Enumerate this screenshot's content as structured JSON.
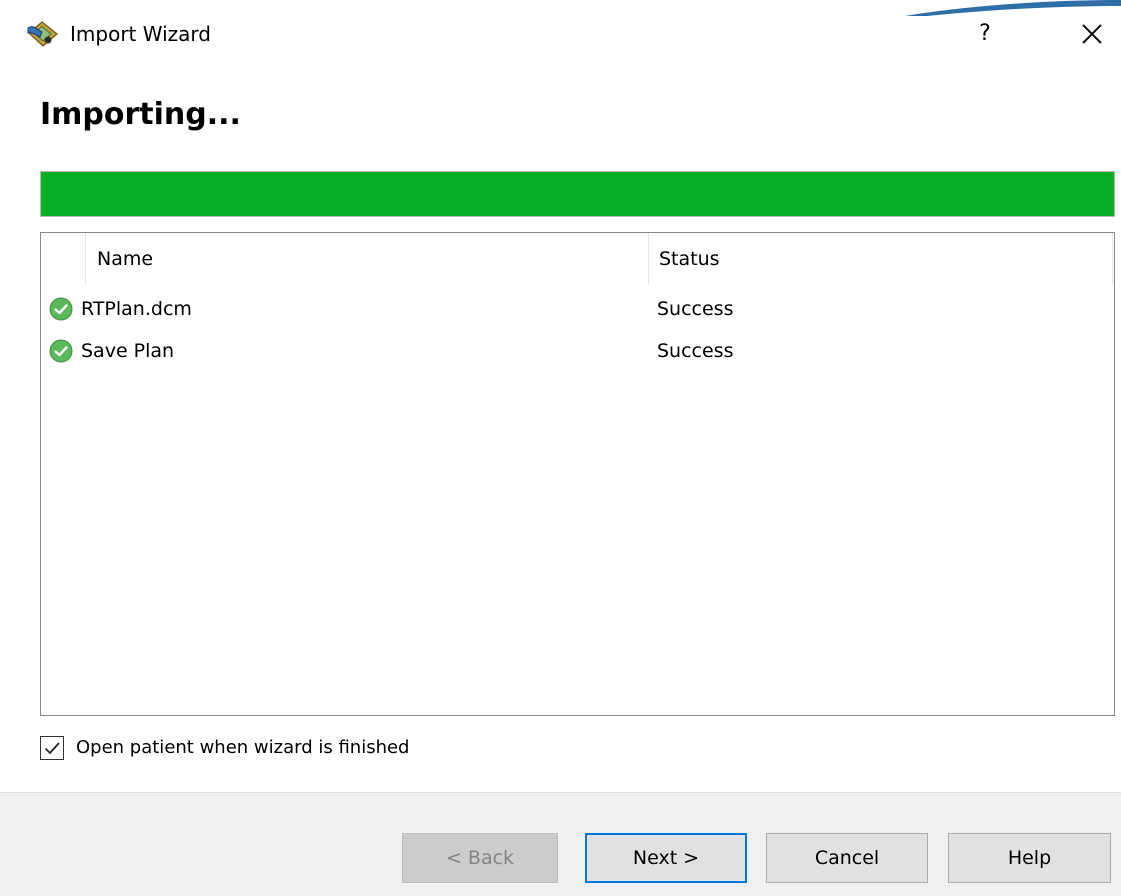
{
  "window": {
    "title": "Import Wizard",
    "help_label": "?",
    "close_icon": "close-icon",
    "app_icon": "import-wizard-icon"
  },
  "page": {
    "heading": "Importing..."
  },
  "progress": {
    "percent": 100,
    "color": "#06b025"
  },
  "results": {
    "columns": [
      "Name",
      "Status"
    ],
    "rows": [
      {
        "icon": "success-check-icon",
        "name": "RTPlan.dcm",
        "status": "Success"
      },
      {
        "icon": "success-check-icon",
        "name": "Save Plan",
        "status": "Success"
      }
    ]
  },
  "options": {
    "open_patient": {
      "label": "Open patient when wizard is finished",
      "checked": true
    }
  },
  "buttons": {
    "back": "< Back",
    "next": "Next >",
    "cancel": "Cancel",
    "help": "Help"
  },
  "colors": {
    "accent": "#0078d7",
    "success": "#5cb85c"
  }
}
